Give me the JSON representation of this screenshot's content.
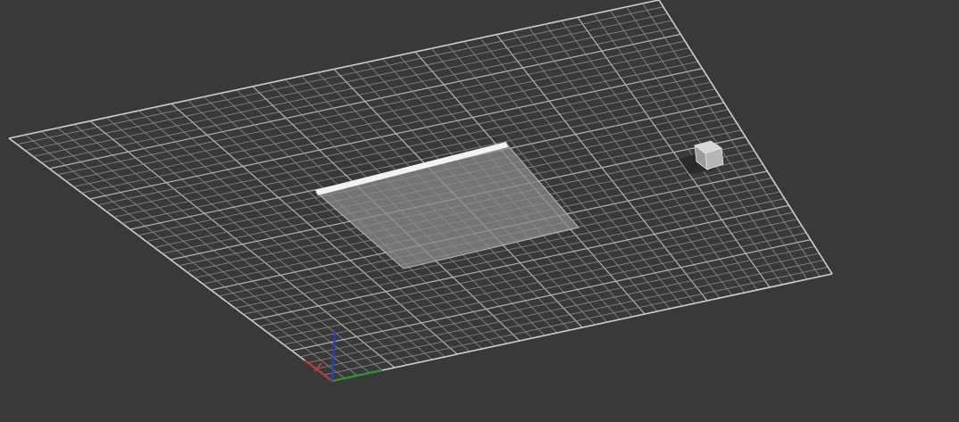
{
  "viewport": {
    "background": "#393939",
    "grid": {
      "visible": true,
      "divisions": 40,
      "major_every": 5,
      "line_color": "#8c8c8c",
      "major_color": "#b4b4b4",
      "border_color": "#cfcfcf"
    },
    "objects": [
      {
        "name": "plane",
        "kind": "flat-slab",
        "color": "#8a8a8a",
        "opacity": 0.75,
        "edge_highlight": "#f2f2f2"
      },
      {
        "name": "box",
        "kind": "small-cube",
        "color": "#9c9c9c"
      }
    ],
    "gizmo": {
      "x_color": "#c23b3b",
      "y_color": "#2f9a2f",
      "z_color": "#2b3bd1"
    }
  }
}
